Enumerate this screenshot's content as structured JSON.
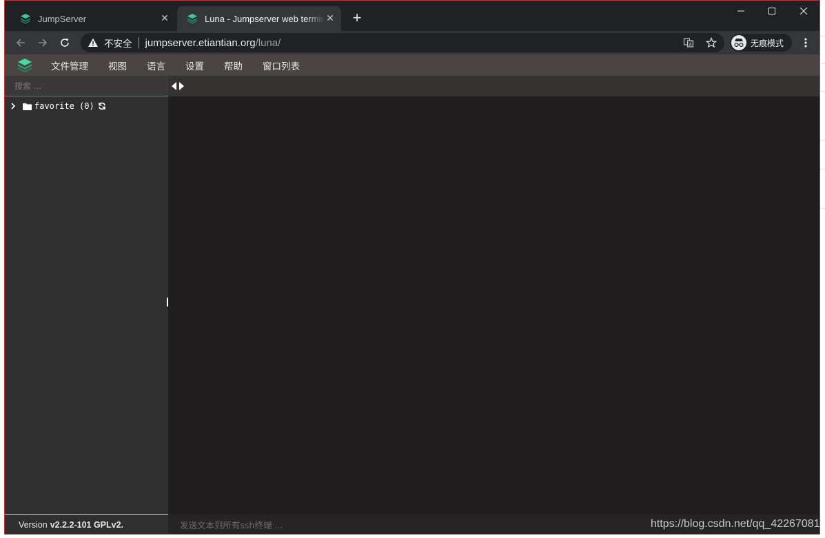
{
  "browser": {
    "tabs": [
      {
        "title": "JumpServer",
        "active": false
      },
      {
        "title": "Luna - Jumpserver web terminal",
        "active": true
      }
    ],
    "address": {
      "security_label": "不安全",
      "host": "jumpserver.etiantian.org",
      "path": "/luna/"
    },
    "profile_label": "无痕模式"
  },
  "luna": {
    "menu": [
      "文件管理",
      "视图",
      "语言",
      "设置",
      "帮助",
      "窗口列表"
    ],
    "search_placeholder": "搜索 ...",
    "tree": [
      {
        "label": "favorite (0)"
      }
    ],
    "version_prefix": "Version",
    "version_value": "v2.2.2-101 GPLv2.",
    "command_placeholder": "发送文本到所有ssh终端 ..."
  },
  "watermark": "https://blog.csdn.net/qq_42267081",
  "colors": {
    "accent": "#17b07a",
    "menubar": "#4a4443",
    "terminal_bg": "#1f1d1d",
    "chrome_dark": "#202124"
  }
}
